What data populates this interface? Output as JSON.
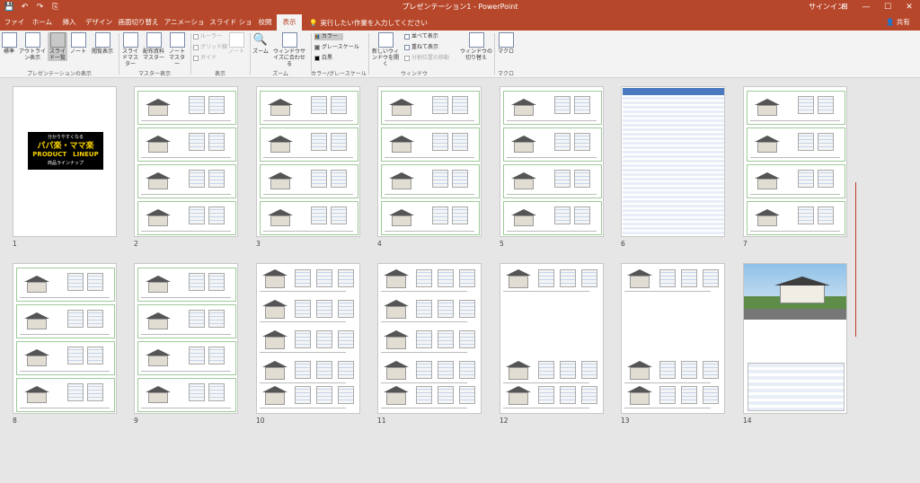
{
  "titlebar": {
    "qat": [
      "💾",
      "↶",
      "↷",
      "⎘"
    ],
    "title": "プレゼンテーション1 - PowerPoint",
    "signin": "サインイン",
    "winbtns": [
      "⊞",
      "—",
      "☐",
      "✕"
    ]
  },
  "tabs": [
    "ファイル",
    "ホーム",
    "挿入",
    "デザイン",
    "画面切り替え",
    "アニメーション",
    "スライド ショー",
    "校閲",
    "表示"
  ],
  "active_tab": "表示",
  "search_placeholder": "実行したい作業を入力してください",
  "share": "共有",
  "ribbon": {
    "presentation_views": [
      "標準",
      "アウトライン表示",
      "スライド一覧",
      "ノート",
      "閲覧表示"
    ],
    "presentation_views_group": "プレゼンテーションの表示",
    "master_views": [
      "スライドマスター",
      "配布資料マスター",
      "ノートマスター"
    ],
    "master_views_group": "マスター表示",
    "show": [
      "ルーラー",
      "グリッド線",
      "ガイド"
    ],
    "show_notes": "ノート",
    "show_group": "表示",
    "zoom": "ズーム",
    "fit_window": "ウィンドウサイズに合わせる",
    "zoom_group": "ズーム",
    "color_options": [
      "カラー",
      "グレースケール",
      "白黒"
    ],
    "color_group": "カラー/グレースケール",
    "new_window": "新しいウィンドウを開く",
    "arrange": [
      "並べて表示",
      "重ねて表示",
      "分割位置の移動"
    ],
    "window_group": "ウィンドウ",
    "switch_window": "ウィンドウの切り替え",
    "macro": "マクロ",
    "macro_group": "マクロ"
  },
  "cover": {
    "line1": "分かりやすくなる",
    "line2": "パパ楽・ママ楽",
    "line3": "PRODUCT　LINEUP",
    "line4": "商品ラインナップ"
  },
  "slide_numbers": [
    "1",
    "2",
    "3",
    "4",
    "5",
    "6",
    "7",
    "8",
    "9",
    "10",
    "11",
    "12",
    "13",
    "14"
  ],
  "selected_slide": "14"
}
